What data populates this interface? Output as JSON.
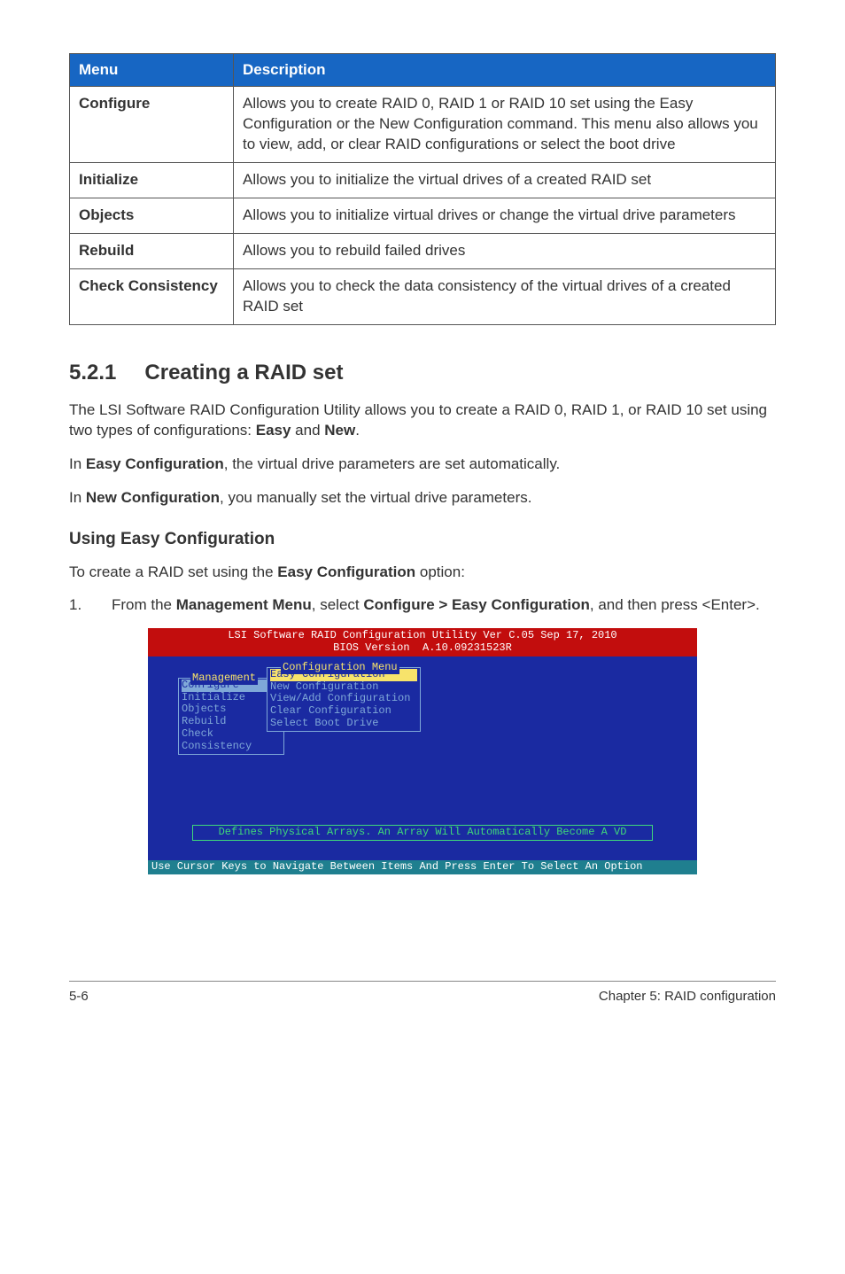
{
  "table": {
    "headers": [
      "Menu",
      "Description"
    ],
    "rows": [
      {
        "menu": "Configure",
        "desc": "Allows you to create RAID 0, RAID 1 or RAID 10 set using the Easy Configuration or the New Configuration command. This menu also allows you to view, add, or clear RAID configurations or select the boot drive"
      },
      {
        "menu": "Initialize",
        "desc": "Allows you to initialize the virtual drives of a created RAID set"
      },
      {
        "menu": "Objects",
        "desc": "Allows you to initialize virtual drives or change the virtual drive parameters"
      },
      {
        "menu": "Rebuild",
        "desc": "Allows you to rebuild failed drives"
      },
      {
        "menu": "Check Consistency",
        "desc": "Allows you to check the data consistency of the virtual drives of a created RAID set"
      }
    ]
  },
  "section": {
    "number": "5.2.1",
    "title": "Creating a RAID set"
  },
  "paragraphs": {
    "p1a": "The LSI Software RAID Configuration Utility allows you to create a RAID 0, RAID 1, or RAID 10 set using two types of configurations: ",
    "p1b_bold1": "Easy",
    "p1c": " and ",
    "p1d_bold2": "New",
    "p1e": ".",
    "p2a": "In ",
    "p2b_bold": "Easy Configuration",
    "p2c": ", the virtual drive parameters are set automatically.",
    "p3a": "In ",
    "p3b_bold": "New Configuration",
    "p3c": ", you manually set the virtual drive parameters."
  },
  "subheading": "Using Easy Configuration",
  "stepintro_a": "To create a RAID set using the ",
  "stepintro_b_bold": "Easy Configuration",
  "stepintro_c": " option:",
  "step1": {
    "num": "1.",
    "a": "From the ",
    "b_bold": "Management Menu",
    "c": ", select ",
    "d_bold": "Configure > Easy Configuration",
    "e": ", and then press <Enter>."
  },
  "bios": {
    "header_line1": "LSI Software RAID Configuration Utility Ver C.05 Sep 17, 2010",
    "header_line2": "BIOS Version  A.10.09231523R",
    "mgmt_title": "Management",
    "mgmt_items": [
      "Configure",
      "Initialize",
      "Objects",
      "Rebuild",
      "Check Consistency"
    ],
    "conf_title": "Configuration Menu",
    "conf_items": [
      "Easy Configuration",
      "New Configuration",
      "View/Add Configuration",
      "Clear Configuration",
      "Select Boot Drive"
    ],
    "message": "Defines Physical Arrays. An Array Will Automatically Become A VD",
    "footer": "Use Cursor Keys to Navigate Between Items And Press Enter To Select An Option"
  },
  "pagefooter": {
    "left": "5-6",
    "right": "Chapter 5: RAID configuration"
  }
}
